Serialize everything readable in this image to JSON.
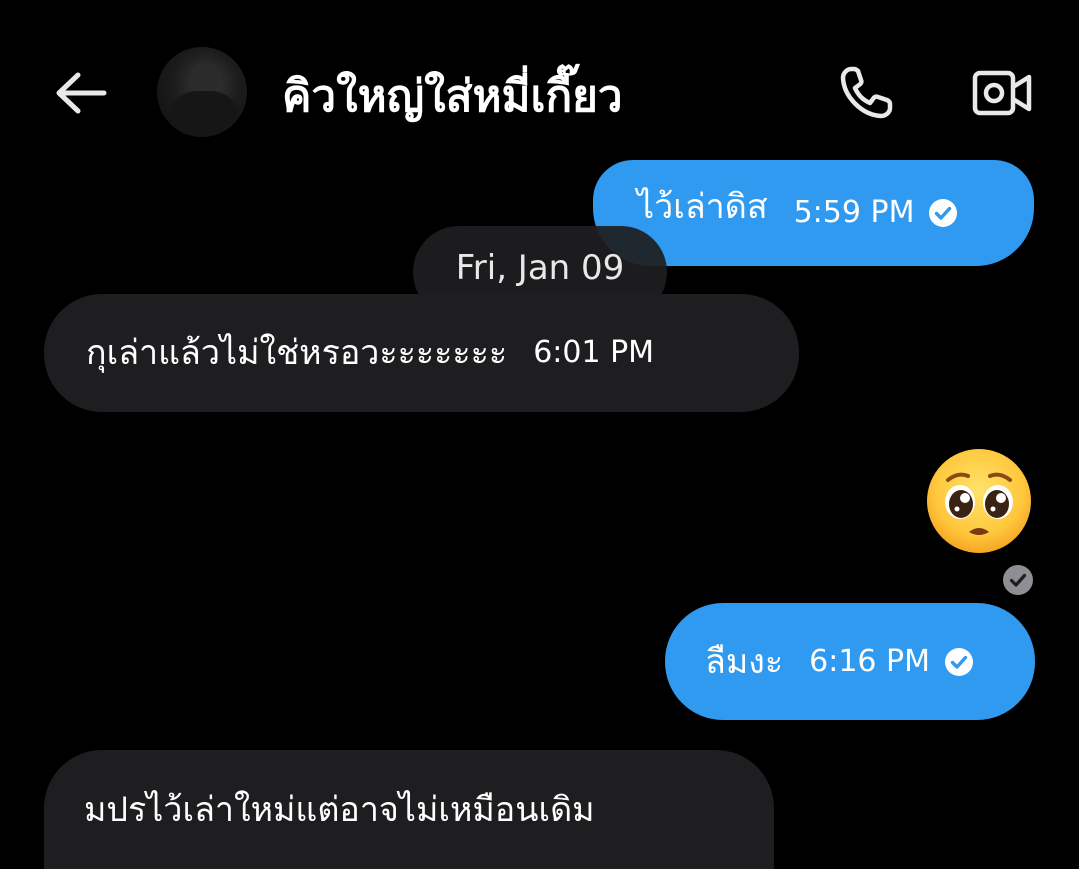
{
  "header": {
    "contact_name": "คิวใหญ่ใส่หมี่เกี๊ยว",
    "back_icon": "arrow-left-icon",
    "call_icon": "phone-icon",
    "video_icon": "video-camera-icon",
    "avatar": "contact-avatar"
  },
  "colors": {
    "background": "#000000",
    "outgoing_bubble": "#2f9af0",
    "incoming_bubble": "#1e1e20",
    "text": "#ffffff"
  },
  "messages": [
    {
      "direction": "outgoing",
      "text": "ไว้เล่าดิส",
      "time": "5:59 PM",
      "status_icon": "check-circle-icon"
    },
    {
      "direction": "incoming",
      "text": "กุเล่าแล้วไม่ใช่หรอวะะะะะะะ",
      "time": "6:01 PM"
    },
    {
      "direction": "outgoing",
      "emoji": "pleading-face-emoji",
      "status_icon": "check-circle-icon"
    },
    {
      "direction": "outgoing",
      "text": "ลืมงะ",
      "time": "6:16 PM",
      "status_icon": "check-circle-icon"
    },
    {
      "direction": "incoming",
      "text": "มปรไว้เล่าใหม่แต่อาจไม่เหมือนเดิม"
    }
  ],
  "date_separator": "Fri, Jan 09"
}
